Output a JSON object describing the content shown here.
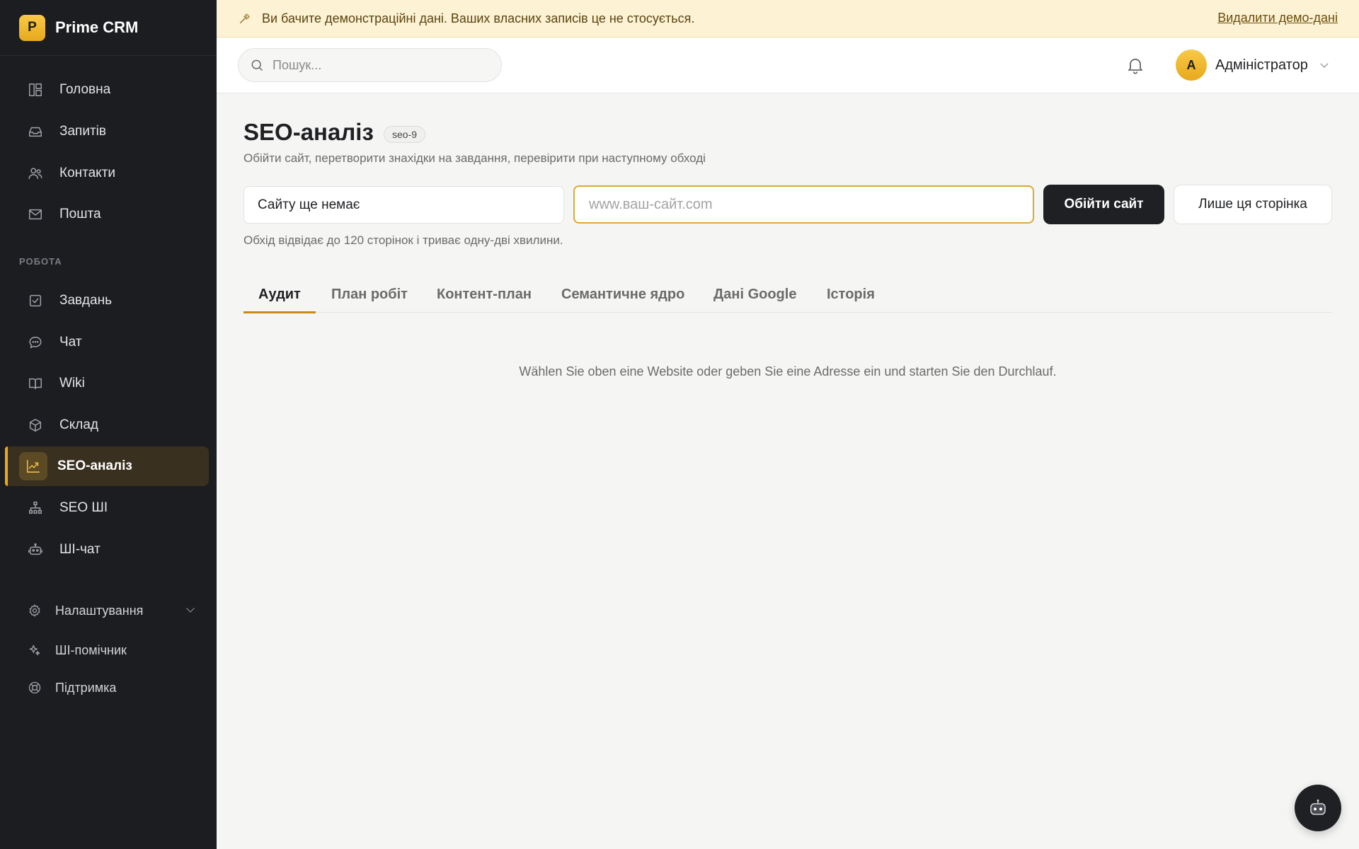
{
  "brand": {
    "logo_letter": "P",
    "name": "Prime CRM"
  },
  "sidebar": {
    "items": [
      {
        "label": "Головна",
        "icon": "layout-icon"
      },
      {
        "label": "Запитів",
        "icon": "inbox-icon"
      },
      {
        "label": "Контакти",
        "icon": "users-icon"
      },
      {
        "label": "Пошта",
        "icon": "mail-icon"
      }
    ],
    "section_label": "РОБОТА",
    "work_items": [
      {
        "label": "Завдань",
        "icon": "check-square-icon"
      },
      {
        "label": "Чат",
        "icon": "chat-icon"
      },
      {
        "label": "Wiki",
        "icon": "book-icon"
      },
      {
        "label": "Склад",
        "icon": "box-icon"
      },
      {
        "label": "SEO-аналіз",
        "icon": "trend-chart-icon",
        "active": true
      },
      {
        "label": "SEO ШІ",
        "icon": "sitemap-icon"
      },
      {
        "label": "ШІ-чат",
        "icon": "robot-icon"
      }
    ],
    "bottom_items": [
      {
        "label": "Налаштування",
        "icon": "gear-icon"
      },
      {
        "label": "ШІ-помічник",
        "icon": "sparkle-icon"
      },
      {
        "label": "Підтримка",
        "icon": "lifebuoy-icon"
      }
    ]
  },
  "banner": {
    "text": "Ви бачите демонстраційні дані. Ваших власних записів це не стосується.",
    "link": "Видалити демо-дані"
  },
  "topbar": {
    "search_placeholder": "Пошук...",
    "avatar_letter": "А",
    "user_name": "Адміністратор"
  },
  "main": {
    "title": "SEO-аналіз",
    "tag": "seo-9",
    "subtitle": "Обійти сайт, перетворити знахідки на завдання, перевірити при наступному обході",
    "site_select_value": "Сайту ще немає",
    "url_placeholder": "www.ваш-сайт.com",
    "crawl_button": "Обійти сайт",
    "single_page_button": "Лише ця сторінка",
    "hint": "Обхід відвідає до 120 сторінок і триває одну-дві хвилини.",
    "tabs": [
      {
        "label": "Аудит",
        "active": true
      },
      {
        "label": "План робіт"
      },
      {
        "label": "Контент-план"
      },
      {
        "label": "Семантичне ядро"
      },
      {
        "label": "Дані Google"
      },
      {
        "label": "Історія"
      }
    ],
    "empty_message": "Wählen Sie oben eine Website oder geben Sie eine Adresse ein und starten Sie den Durchlauf."
  },
  "colors": {
    "accent": "#e8a91c",
    "sidebar_bg": "#1c1d21",
    "banner_bg": "#fdf2d4"
  }
}
